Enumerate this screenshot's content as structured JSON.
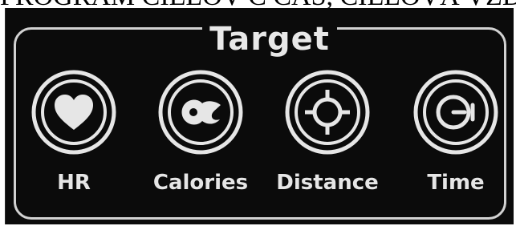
{
  "caption": {
    "text": "PROGRAM CIEĽOV Č ČAS, CIEĽOVÁ VZDIALE"
  },
  "panel": {
    "title": "Target",
    "items": [
      {
        "label": "HR",
        "icon": "heart-icon"
      },
      {
        "label": "Calories",
        "icon": "flame-icon"
      },
      {
        "label": "Distance",
        "icon": "crosshair-icon"
      },
      {
        "label": "Time",
        "icon": "stopwatch-icon"
      }
    ]
  },
  "colors": {
    "background": "#0b0b0b",
    "foreground": "#e6e6e6",
    "frame": "#d2d2d2"
  }
}
